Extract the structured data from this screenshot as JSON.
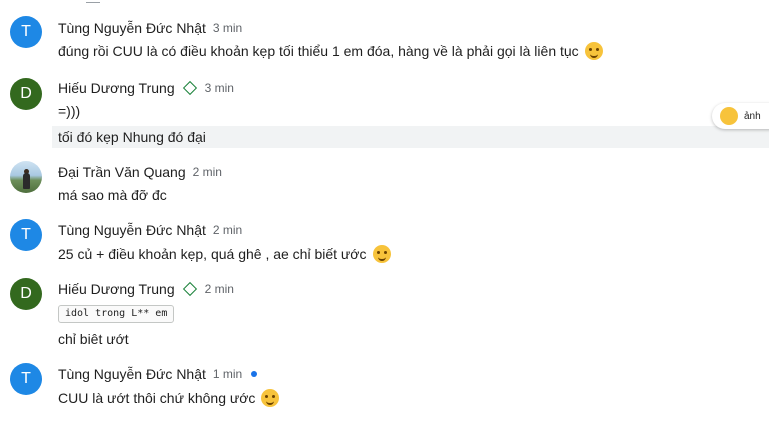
{
  "messages": [
    {
      "avatar_letter": "T",
      "name": "Tùng Nguyễn Đức Nhật",
      "time": "3 min",
      "lines": [
        "đúng rồi CUU là có điều khoản kẹp tối thiểu 1 em đóa, hàng về là phải gọi là liên tục"
      ],
      "emoji": "grinning-sweat-face"
    },
    {
      "avatar_letter": "D",
      "name": "Hiếu Dương Trung",
      "time": "3 min",
      "lines": [
        "=)))",
        "tối đó kẹp Nhung đó đại"
      ],
      "verified": true
    },
    {
      "name": "Đại Trần Văn Quang",
      "time": "2 min",
      "lines": [
        "má sao mà đỡ đc"
      ]
    },
    {
      "avatar_letter": "T",
      "name": "Tùng Nguyễn Đức Nhật",
      "time": "2 min",
      "lines": [
        "25 củ + điều khoản kẹp, quá ghê , ae chỉ biết ước"
      ],
      "emoji": "drooling-face"
    },
    {
      "avatar_letter": "D",
      "name": "Hiếu Dương Trung",
      "time": "2 min",
      "code": "idol trong L** em",
      "lines": [
        "chỉ biêt ướt"
      ],
      "verified": true
    },
    {
      "avatar_letter": "T",
      "name": "Tùng Nguyễn Đức Nhật",
      "time": "1 min",
      "lines": [
        "CUU là ướt thôi chứ không ước"
      ],
      "emoji": "smiling-face-hand-over-mouth",
      "unread": true
    }
  ],
  "reaction_popup": {
    "emoji": "rolling-on-floor-laughing",
    "label": "ảnh"
  },
  "colors": {
    "avatar_blue": "#1e88e5",
    "avatar_green": "#33691e",
    "time_gray": "#5f6368",
    "verified_green": "#188038",
    "unread_blue": "#1a73e8"
  }
}
